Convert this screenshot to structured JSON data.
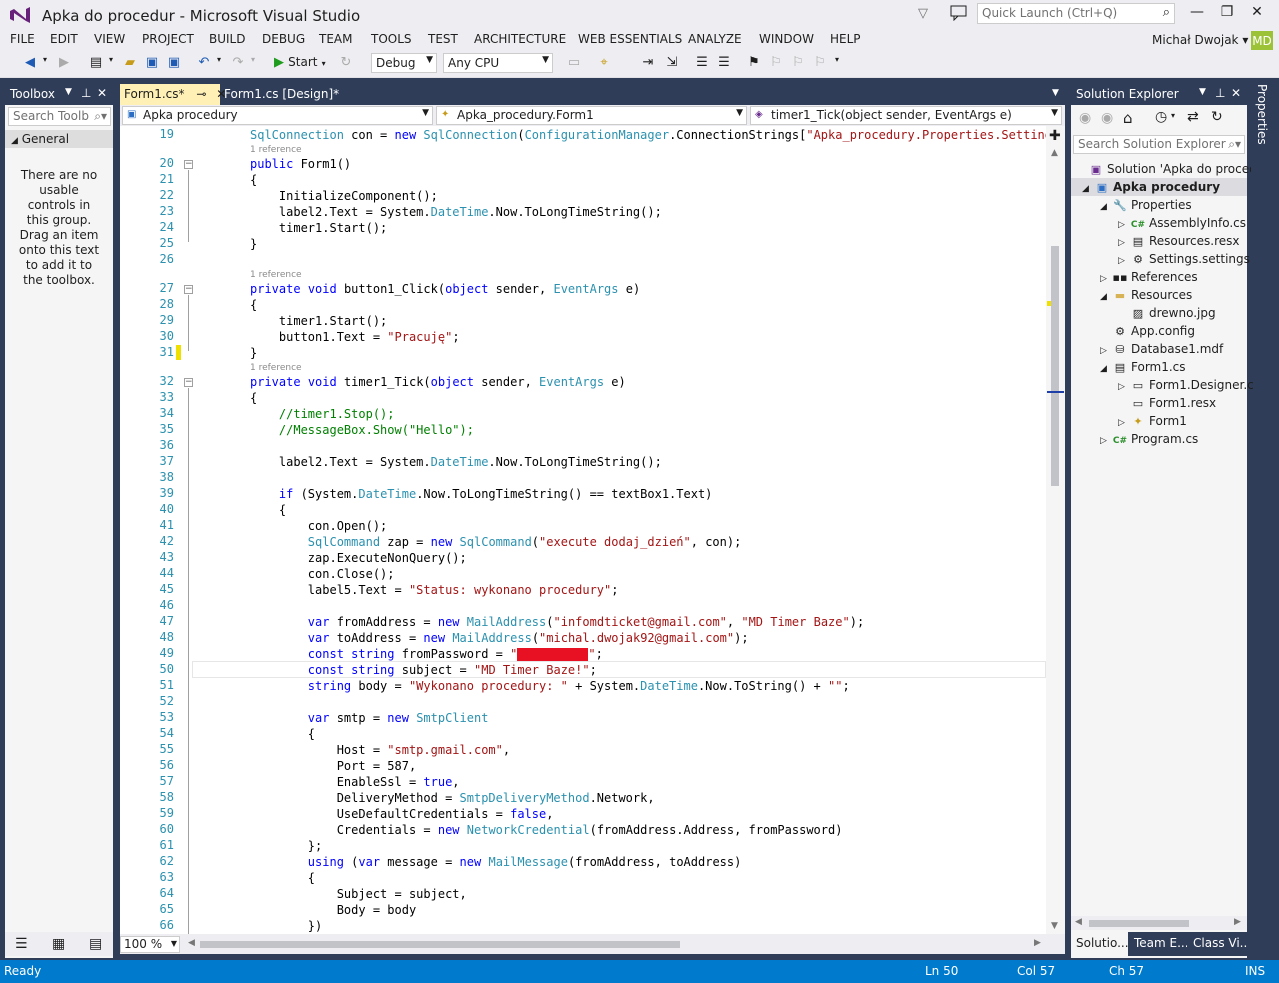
{
  "window": {
    "title": "Apka do procedur - Microsoft Visual Studio",
    "quick_launch_placeholder": "Quick Launch (Ctrl+Q)"
  },
  "menu": [
    "FILE",
    "EDIT",
    "VIEW",
    "PROJECT",
    "BUILD",
    "DEBUG",
    "TEAM",
    "TOOLS",
    "TEST",
    "ARCHITECTURE",
    "WEB ESSENTIALS",
    "ANALYZE",
    "WINDOW",
    "HELP"
  ],
  "user": {
    "name": "Michał Dwojak",
    "initials": "MD"
  },
  "toolbar": {
    "start_label": "Start",
    "config": "Debug",
    "platform": "Any CPU"
  },
  "toolbox": {
    "title": "Toolbox",
    "search_placeholder": "Search Toolb",
    "group": "General",
    "message": "There are no usable controls in this group. Drag an item onto this text to add it to the toolbox."
  },
  "editor": {
    "tabs": [
      {
        "label": "Form1.cs*",
        "pin": "⊸"
      },
      {
        "label": "Form1.cs [Design]*"
      }
    ],
    "nav": {
      "project": "Apka procedury",
      "class": "Apka_procedury.Form1",
      "member": "timer1_Tick(object sender, EventArgs e)"
    },
    "zoom": "100 %",
    "reference_label": "1 reference",
    "line_numbers": [
      "19",
      "20",
      "21",
      "22",
      "23",
      "24",
      "25",
      "26",
      "27",
      "28",
      "29",
      "30",
      "31",
      "32",
      "33",
      "34",
      "35",
      "36",
      "37",
      "38",
      "39",
      "40",
      "41",
      "42",
      "43",
      "44",
      "45",
      "46",
      "47",
      "48",
      "49",
      "50",
      "51",
      "52",
      "53",
      "54",
      "55",
      "56",
      "57",
      "58",
      "59",
      "60",
      "61",
      "62",
      "63",
      "64",
      "65",
      "66"
    ]
  },
  "solution_explorer": {
    "title": "Solution Explorer",
    "search_placeholder": "Search Solution Explorer (",
    "items": [
      "Solution 'Apka do procedu",
      "Apka procedury",
      "Properties",
      "AssemblyInfo.cs",
      "Resources.resx",
      "Settings.settings",
      "References",
      "Resources",
      "drewno.jpg",
      "App.config",
      "Database1.mdf",
      "Form1.cs",
      "Form1.Designer.c",
      "Form1.resx",
      "Form1",
      "Program.cs"
    ],
    "bottom_tabs": [
      "Solutio...",
      "Team E...",
      "Class Vi..."
    ]
  },
  "properties_tab": "Properties",
  "status": {
    "ready": "Ready",
    "ln": "Ln 50",
    "col": "Col 57",
    "ch": "Ch 57",
    "ins": "INS"
  }
}
